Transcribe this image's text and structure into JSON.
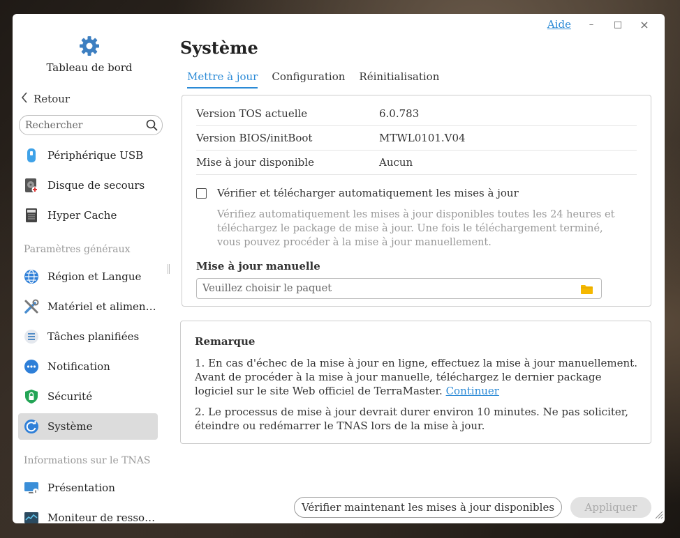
{
  "window": {
    "help_label": "Aide",
    "minimize_glyph": "–",
    "maximize_glyph": "□",
    "close_glyph": "×"
  },
  "sidebar": {
    "dashboard_label": "Tableau de bord",
    "back_label": "Retour",
    "search_placeholder": "Rechercher",
    "items_top": [
      {
        "label": "Périphérique USB",
        "icon": "usb-icon"
      },
      {
        "label": "Disque de secours",
        "icon": "rescue-disk-icon"
      },
      {
        "label": "Hyper Cache",
        "icon": "ssd-cache-icon"
      }
    ],
    "section_general": "Paramètres généraux",
    "items_general": [
      {
        "label": "Région et Langue",
        "icon": "globe-icon"
      },
      {
        "label": "Matériel et alimenta…",
        "icon": "tools-icon"
      },
      {
        "label": "Tâches planifiées",
        "icon": "tasks-icon"
      },
      {
        "label": "Notification",
        "icon": "chat-bubble-icon"
      },
      {
        "label": "Sécurité",
        "icon": "shield-lock-icon"
      },
      {
        "label": "Système",
        "icon": "system-update-icon",
        "active": true
      }
    ],
    "section_info": "Informations sur le TNAS",
    "items_info": [
      {
        "label": "Présentation",
        "icon": "monitor-info-icon"
      },
      {
        "label": "Moniteur de ressour…",
        "icon": "resource-monitor-icon"
      }
    ]
  },
  "main": {
    "title": "Système",
    "tabs": [
      {
        "label": "Mettre à jour",
        "active": true
      },
      {
        "label": "Configuration"
      },
      {
        "label": "Réinitialisation"
      }
    ],
    "info_rows": [
      {
        "key": "Version TOS actuelle",
        "value": "6.0.783"
      },
      {
        "key": "Version BIOS/initBoot",
        "value": "MTWL0101.V04"
      },
      {
        "key": "Mise à jour disponible",
        "value": "Aucun"
      }
    ],
    "auto_update_label": "Vérifier et télécharger automatiquement les mises à jour",
    "auto_update_checked": false,
    "auto_update_desc": "Vérifiez automatiquement les mises à jour disponibles toutes les 24 heures et téléchargez le package de mise à jour. Une fois le téléchargement terminé, vous pouvez procéder à la mise à jour manuellement.",
    "manual_title": "Mise à jour manuelle",
    "file_placeholder": "Veuillez choisir le paquet",
    "note_title": "Remarque",
    "note1_text": "1. En cas d'échec de la mise à jour en ligne, effectuez la mise à jour manuellement. Avant de procéder à la mise à jour manuelle, téléchargez le dernier package logiciel sur le site Web officiel de TerraMaster.",
    "note1_link": "Continuer",
    "note2_text": "2. Le processus de mise à jour devrait durer environ 10 minutes. Ne pas soliciter, éteindre ou redémarrer le TNAS lors de la mise à jour.",
    "check_button": "Vérifier maintenant les mises à jour disponibles",
    "apply_button": "Appliquer"
  },
  "colors": {
    "accent": "#2b8ad6",
    "active_item_bg": "#dcdcdc",
    "disabled_button_bg": "#e2e2e2"
  }
}
